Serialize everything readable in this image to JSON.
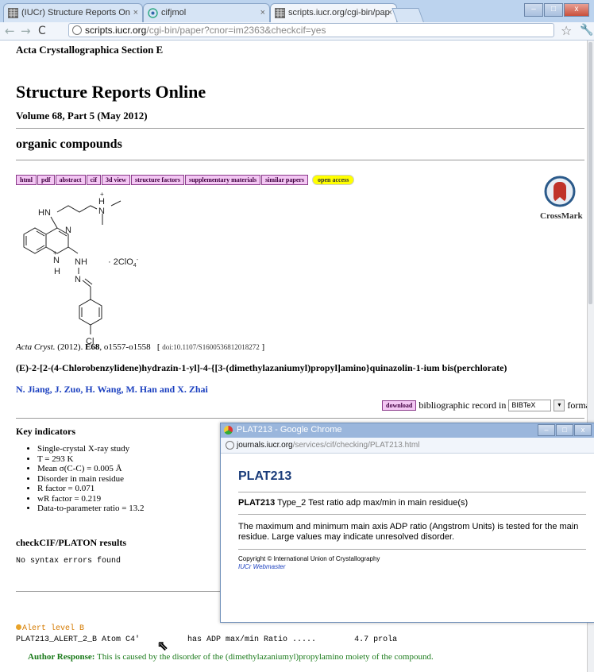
{
  "browser": {
    "tabs": [
      {
        "label": "(IUCr) Structure Reports On",
        "active": false
      },
      {
        "label": "cifjmol",
        "active": false
      },
      {
        "label": "scripts.iucr.org/cgi-bin/pap",
        "active": true
      }
    ],
    "url_host": "scripts.iucr.org",
    "url_path": "/cgi-bin/paper?cnor=im2363&checkcif=yes"
  },
  "page": {
    "section": "Acta Crystallographica Section E",
    "title": "Structure Reports Online",
    "volume": "Volume 68, Part 5 (May 2012)",
    "category": "organic compounds",
    "links": [
      "html",
      "pdf",
      "abstract",
      "cif",
      "3d view",
      "structure factors",
      "supplementary materials",
      "similar papers"
    ],
    "open_access": "open access",
    "crossmark": "CrossMark",
    "molecule": {
      "hn": "HN",
      "h_plus": "+",
      "h_top": "H",
      "n_top": "N",
      "n1": "N",
      "n_plus": "+",
      "n2": "N",
      "nh": "NH",
      "h_bottom": "H",
      "n3": "N",
      "cl": "Cl",
      "counter_ion": "· 2ClO",
      "counter_sub": "4",
      "counter_sup": "-"
    },
    "citation": {
      "journal": "Acta Cryst.",
      "year": "(2012).",
      "vol": "E68",
      "pages": ", o1557-o1558",
      "doi_open": "[",
      "doi": "doi:10.1107/S1600536812018272",
      "doi_close": "]"
    },
    "article_title": "(E)-2-[2-(4-Chlorobenzylidene)hydrazin-1-yl]-4-{[3-(dimethylazaniumyl)propyl]amino}quinazolin-1-ium bis(perchlorate)",
    "authors": "N. Jiang, J. Zuo, H. Wang, M. Han and X. Zhai",
    "download_label": "download",
    "biblio_text": "bibliographic record in",
    "format_value": "BIBTeX",
    "format_text": "format",
    "key_indicators_heading": "Key indicators",
    "key_indicators": [
      "Single-crystal X-ray study",
      "T = 293 K",
      "Mean σ(C-C) = 0.005 Å",
      "Disorder in main residue",
      "R factor = 0.071",
      "wR factor = 0.219",
      "Data-to-parameter ratio = 13.2"
    ],
    "checkcif_heading": "checkCIF/PLATON results",
    "checkcif_text": "No syntax errors found",
    "alert_level": "Alert level B",
    "alert_line": "PLAT213_ALERT_2_B Atom C4'          has ADP max/min Ratio .....        4.7 prola",
    "author_response_label": "Author Response:",
    "author_response_text": "This is caused by the disorder of the (dimethylazaniumyl)propylamino moiety of the compound."
  },
  "popup": {
    "window_title": "PLAT213 - Google Chrome",
    "url_host": "journals.iucr.org",
    "url_path": "/services/cif/checking/PLAT213.html",
    "heading": "PLAT213",
    "subtitle_code": "PLAT213",
    "subtitle_text": "Type_2 Test ratio adp max/min in main residue(s)",
    "body": "The maximum and minimum main axis ADP ratio (Angstrom Units) is tested for the main residue. Large values may indicate unresolved disorder.",
    "copyright": "Copyright © International Union of Crystallography",
    "webmaster": "IUCr Webmaster"
  },
  "colors": {
    "link_box": "#f3c7f3",
    "open_access": "#ffff00",
    "authors": "#1a3fbf",
    "alert": "#d47a00",
    "author_response": "#1a7a1a",
    "popup_heading": "#1a3c7a"
  }
}
